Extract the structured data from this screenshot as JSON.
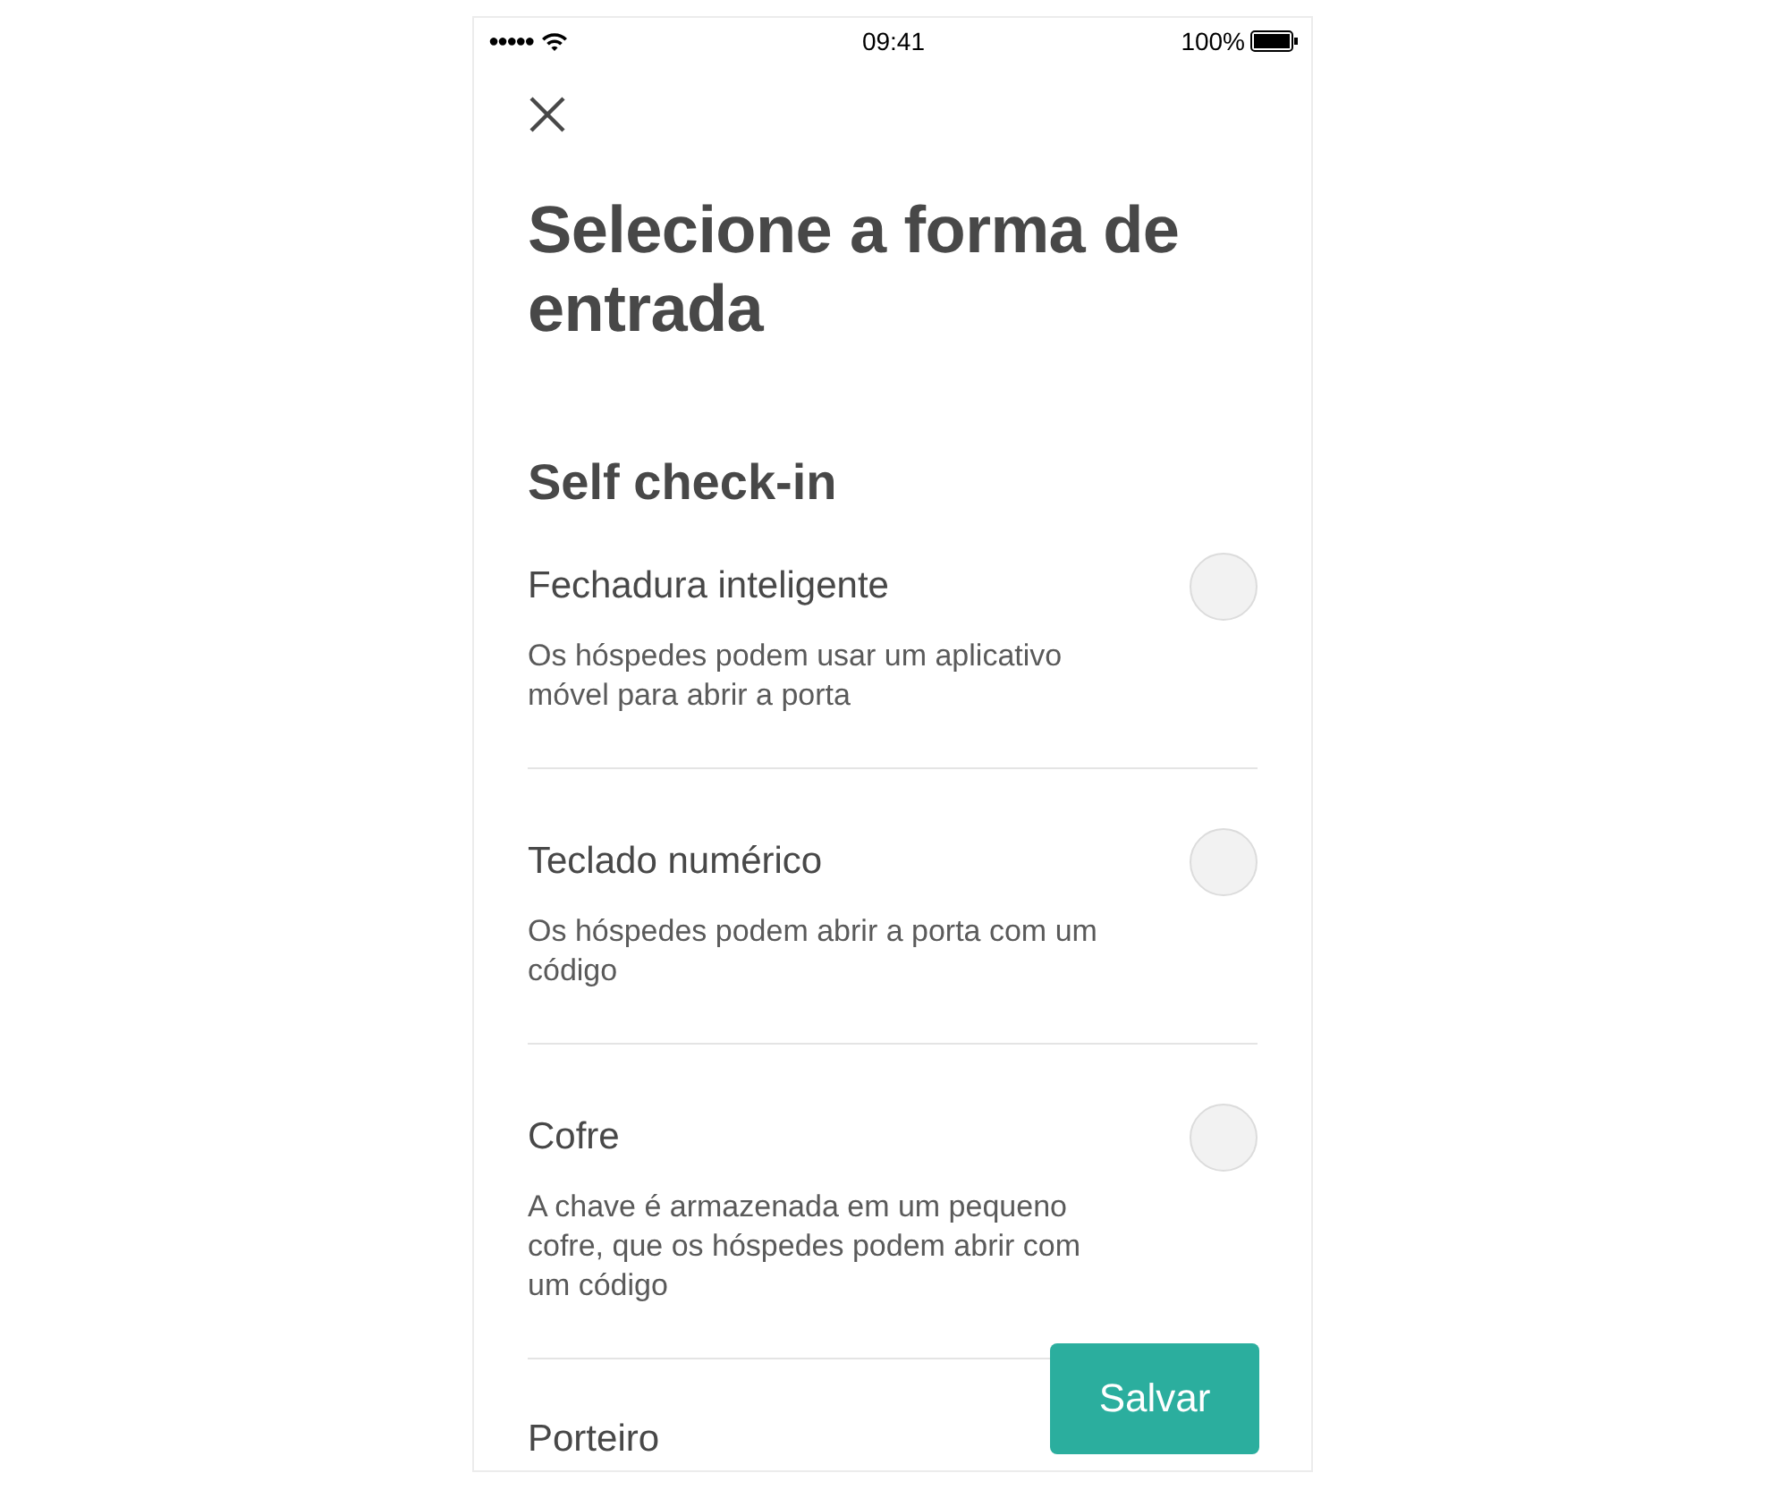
{
  "status_bar": {
    "signal": "●●●●●",
    "time": "09:41",
    "battery": "100%"
  },
  "title": "Selecione a forma de entrada",
  "section": "Self check-in",
  "options": [
    {
      "label": "Fechadura inteligente",
      "description": "Os hóspedes podem usar um aplicativo móvel para abrir a porta",
      "selected": false
    },
    {
      "label": "Teclado numérico",
      "description": "Os hóspedes podem abrir a porta com um código",
      "selected": false
    },
    {
      "label": "Cofre",
      "description": "A chave é armazenada em um pequeno cofre, que os hóspedes podem abrir com um código",
      "selected": false
    },
    {
      "label": "Porteiro"
    }
  ],
  "save_button": "Salvar"
}
